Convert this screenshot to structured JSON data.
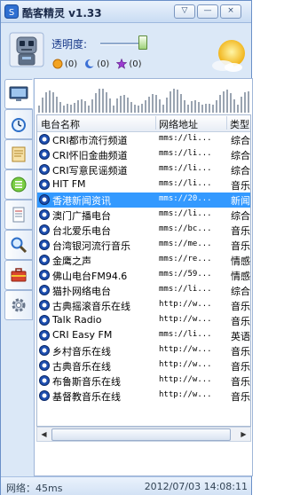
{
  "window": {
    "title": "酷客精灵 v1.33"
  },
  "title_buttons": [
    "▽",
    "—",
    "×"
  ],
  "top": {
    "transparency_label": "透明度:",
    "status_counts": [
      {
        "icon": "orange-circle-icon",
        "color": "#f3a321",
        "count": "(0)"
      },
      {
        "icon": "blue-moon-icon",
        "color": "#3b6fd6",
        "count": "(0)"
      },
      {
        "icon": "purple-star-icon",
        "color": "#9b3bd1",
        "count": "(0)"
      }
    ]
  },
  "list": {
    "columns": [
      "电台名称",
      "网络地址",
      "类型"
    ],
    "rows": [
      {
        "name": "CRI都市流行频道",
        "url": "mms://li...",
        "type": "综合"
      },
      {
        "name": "CRI怀旧金曲频道",
        "url": "mms://li...",
        "type": "综合"
      },
      {
        "name": "CRI写意民谣频道",
        "url": "mms://li...",
        "type": "综合"
      },
      {
        "name": "HIT FM",
        "url": "mms://li...",
        "type": "音乐"
      },
      {
        "name": "香港新闻资讯",
        "url": "mms://20...",
        "type": "新闻",
        "selected": true
      },
      {
        "name": "澳门广播电台",
        "url": "mms://li...",
        "type": "综合"
      },
      {
        "name": "台北爱乐电台",
        "url": "mms://bc...",
        "type": "音乐"
      },
      {
        "name": "台湾银河流行音乐",
        "url": "mms://me...",
        "type": "音乐"
      },
      {
        "name": "金鹰之声",
        "url": "mms://re...",
        "type": "情感"
      },
      {
        "name": "佛山电台FM94.6",
        "url": "mms://59...",
        "type": "情感"
      },
      {
        "name": "猫扑网络电台",
        "url": "mms://li...",
        "type": "综合"
      },
      {
        "name": "古典摇滚音乐在线",
        "url": "http://w...",
        "type": "音乐"
      },
      {
        "name": "Talk Radio",
        "url": "http://w...",
        "type": "音乐"
      },
      {
        "name": "CRI Easy FM",
        "url": "mms://li...",
        "type": "英语"
      },
      {
        "name": "乡村音乐在线",
        "url": "http://w...",
        "type": "音乐"
      },
      {
        "name": "古典音乐在线",
        "url": "http://w...",
        "type": "音乐"
      },
      {
        "name": "布鲁斯音乐在线",
        "url": "http://w...",
        "type": "音乐"
      },
      {
        "name": "基督教音乐在线",
        "url": "http://w...",
        "type": "音乐"
      }
    ]
  },
  "status": {
    "network": "网络：45ms",
    "datetime": "2012/07/03 14:08:11"
  },
  "colors": {
    "accent": "#3399ff",
    "border": "#6a90c8"
  }
}
